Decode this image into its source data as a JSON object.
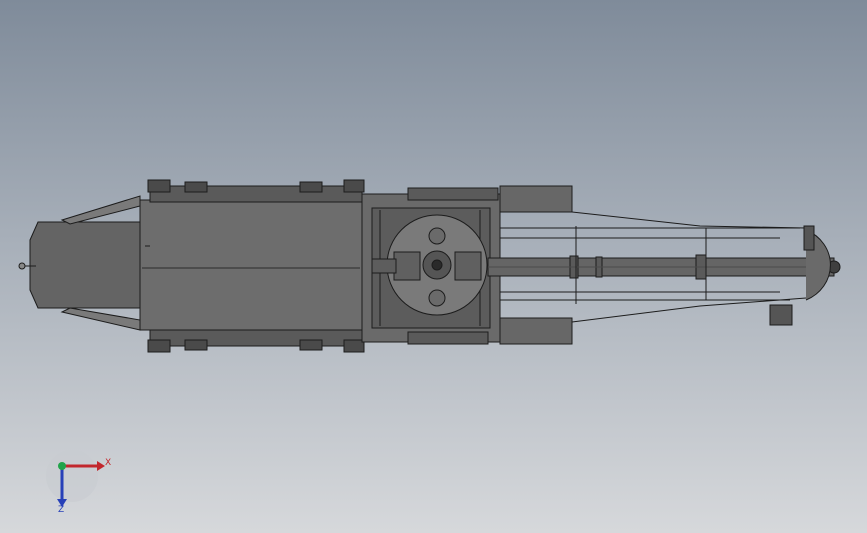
{
  "viewport": {
    "background_top": "#7f8b9a",
    "background_bottom": "#d6d8db"
  },
  "model": {
    "body_color": "#6f6f6f",
    "body_dark": "#3d3d3d",
    "edge_color": "#1c1c1c",
    "barrel_color": "#5f5f5f"
  },
  "triad": {
    "x_label": "X",
    "z_label": "Z",
    "x_color": "#c2272d",
    "y_color": "#21a34a",
    "z_color": "#2740b8"
  }
}
